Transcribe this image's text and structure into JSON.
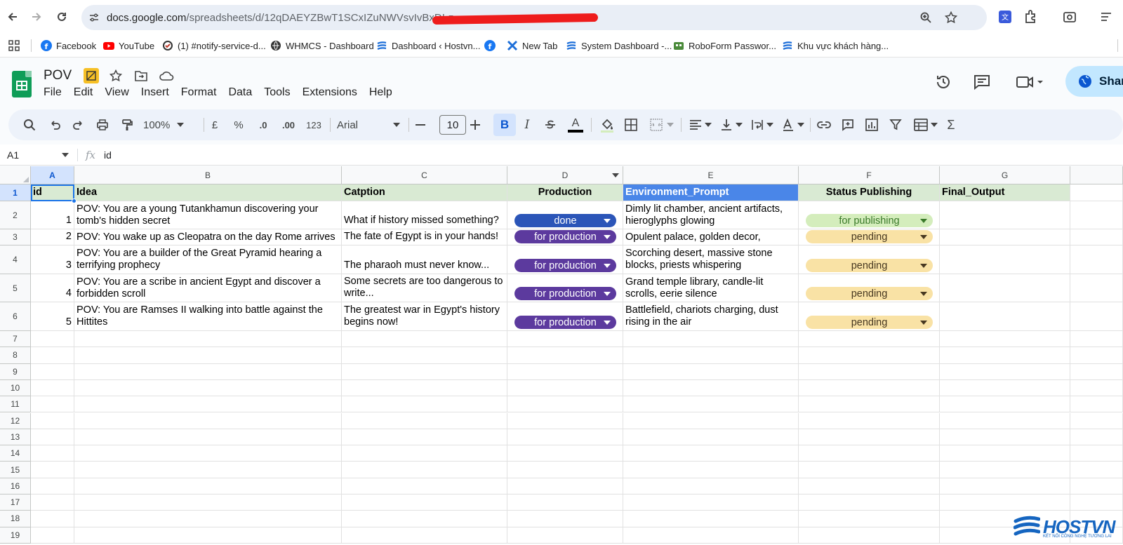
{
  "browser": {
    "url_host": "docs.google.com",
    "url_path": "/spreadsheets/d/12qDAEYZBwT1SCxIZuNWVsvIvBxDI-z",
    "bookmarks": [
      {
        "label": "Facebook"
      },
      {
        "label": "YouTube"
      },
      {
        "label": "(1) #notify-service-d..."
      },
      {
        "label": "WHMCS - Dashboard"
      },
      {
        "label": "Dashboard ‹ Hostvn..."
      },
      {
        "label": ""
      },
      {
        "label": "New Tab"
      },
      {
        "label": "System Dashboard -..."
      },
      {
        "label": "RoboForm Passwor..."
      },
      {
        "label": "Khu vực khách hàng..."
      }
    ]
  },
  "sheets": {
    "doc_title": "POV",
    "menu": [
      "File",
      "Edit",
      "View",
      "Insert",
      "Format",
      "Data",
      "Tools",
      "Extensions",
      "Help"
    ],
    "share_label": "Shar",
    "toolbar": {
      "zoom": "100%",
      "currency": "£",
      "percent": "%",
      "dec_decrease": ".0",
      "dec_increase": ".00",
      "number_format": "123",
      "font": "Arial",
      "font_size": "10",
      "bold": "B",
      "italic": "I",
      "text_color": "A",
      "sum": "Σ"
    },
    "formula_bar": {
      "cell_ref": "A1",
      "fx": "fx",
      "content": "id"
    }
  },
  "grid": {
    "column_letters": [
      "A",
      "B",
      "C",
      "D",
      "E",
      "F",
      "G"
    ],
    "row_numbers": [
      "1",
      "2",
      "3",
      "4",
      "5",
      "6",
      "7",
      "8",
      "9",
      "10",
      "11",
      "12",
      "13",
      "14",
      "15",
      "16",
      "17",
      "18",
      "19"
    ],
    "headers": [
      "id",
      "Idea",
      "Catption",
      "Production",
      "Environment_Prompt",
      "Status Publishing",
      "Final_Output"
    ],
    "rows": [
      {
        "id": "1",
        "idea": "POV: You are a young Tutankhamun discovering your tomb's hidden secret",
        "caption": "What if history missed something?",
        "production": "done",
        "environment": "Dimly lit chamber, ancient artifacts, hieroglyphs glowing",
        "status": "for publishing",
        "final": ""
      },
      {
        "id": "2",
        "idea": "POV: You wake up as Cleopatra on the day Rome arrives",
        "caption": "The fate of Egypt is in your hands!",
        "production": "for production",
        "environment": "Opulent palace, golden decor, Roman",
        "status": "pending",
        "final": ""
      },
      {
        "id": "3",
        "idea": "POV: You are a builder of the Great Pyramid hearing a terrifying prophecy",
        "caption": "The pharaoh must never know...",
        "production": "for production",
        "environment": "Scorching desert, massive stone blocks, priests whispering",
        "status": "pending",
        "final": ""
      },
      {
        "id": "4",
        "idea": "POV: You are a scribe in ancient Egypt and discover a forbidden scroll",
        "caption": "Some secrets are too dangerous to write...",
        "production": "for production",
        "environment": "Grand temple library, candle-lit scrolls, eerie silence",
        "status": "pending",
        "final": ""
      },
      {
        "id": "5",
        "idea": "POV: You are Ramses II walking into battle against the Hittites",
        "caption": "The greatest war in Egypt's history begins now!",
        "production": "for production",
        "environment": "Battlefield, chariots charging, dust rising in the air",
        "status": "pending",
        "final": ""
      }
    ]
  },
  "colors": {
    "header_fill": "#d9ead3",
    "env_header_fill": "#4a86e8",
    "chip_done": "#2b55b8",
    "chip_production": "#5c3a9e",
    "chip_publishing": "#d4edbc",
    "chip_pending": "#f9e2a5"
  },
  "watermark": {
    "brand": "HOSTVN",
    "tagline": "KẾT NỐI CÔNG NGHỆ TƯƠNG LAI"
  }
}
